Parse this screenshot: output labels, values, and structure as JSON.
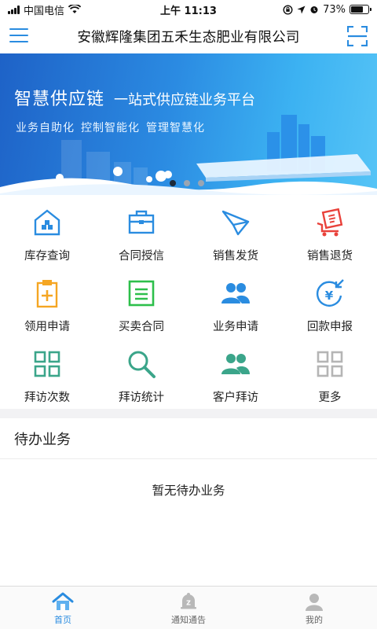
{
  "status_bar": {
    "carrier": "中国电信",
    "time": "上午 11:13",
    "battery": "73%",
    "battery_level": 0.73
  },
  "header": {
    "title": "安徽辉隆集团五禾生态肥业有限公司",
    "menu_icon": "menu-icon",
    "scan_icon": "scan-icon"
  },
  "banner": {
    "title": "智慧供应链",
    "subtitle": "一站式供应链业务平台",
    "tags": [
      "业务自助化",
      "控制智能化",
      "管理智慧化"
    ],
    "slide_count": 3,
    "active_slide": 1
  },
  "grid": [
    {
      "label": "库存查询",
      "icon": "warehouse-icon",
      "color": "#2a8ce0"
    },
    {
      "label": "合同授信",
      "icon": "briefcase-icon",
      "color": "#2a8ce0"
    },
    {
      "label": "销售发货",
      "icon": "paper-plane-icon",
      "color": "#2a8ce0"
    },
    {
      "label": "销售退货",
      "icon": "cart-return-icon",
      "color": "#e9423b"
    },
    {
      "label": "领用申请",
      "icon": "clipboard-plus-icon",
      "color": "#f5a623"
    },
    {
      "label": "买卖合同",
      "icon": "contract-icon",
      "color": "#2dbf4b"
    },
    {
      "label": "业务申请",
      "icon": "people-icon",
      "color": "#2a8ce0"
    },
    {
      "label": "回款申报",
      "icon": "yen-return-icon",
      "color": "#2a8ce0"
    },
    {
      "label": "拜访次数",
      "icon": "grid-icon",
      "color": "#3ba58a"
    },
    {
      "label": "拜访统计",
      "icon": "search-icon",
      "color": "#3ba58a"
    },
    {
      "label": "客户拜访",
      "icon": "people-icon",
      "color": "#3ba58a"
    },
    {
      "label": "更多",
      "icon": "grid-more-icon",
      "color": "#b5b5b5"
    }
  ],
  "todo": {
    "title": "待办业务",
    "empty_text": "暂无待办业务"
  },
  "tabbar": [
    {
      "label": "首页",
      "icon": "home-icon",
      "active": true
    },
    {
      "label": "通知通告",
      "icon": "bell-icon",
      "active": false
    },
    {
      "label": "我的",
      "icon": "user-icon",
      "active": false
    }
  ],
  "colors": {
    "accent": "#2a8ce0",
    "banner_start": "#1e62c7",
    "banner_end": "#56c4f6"
  }
}
